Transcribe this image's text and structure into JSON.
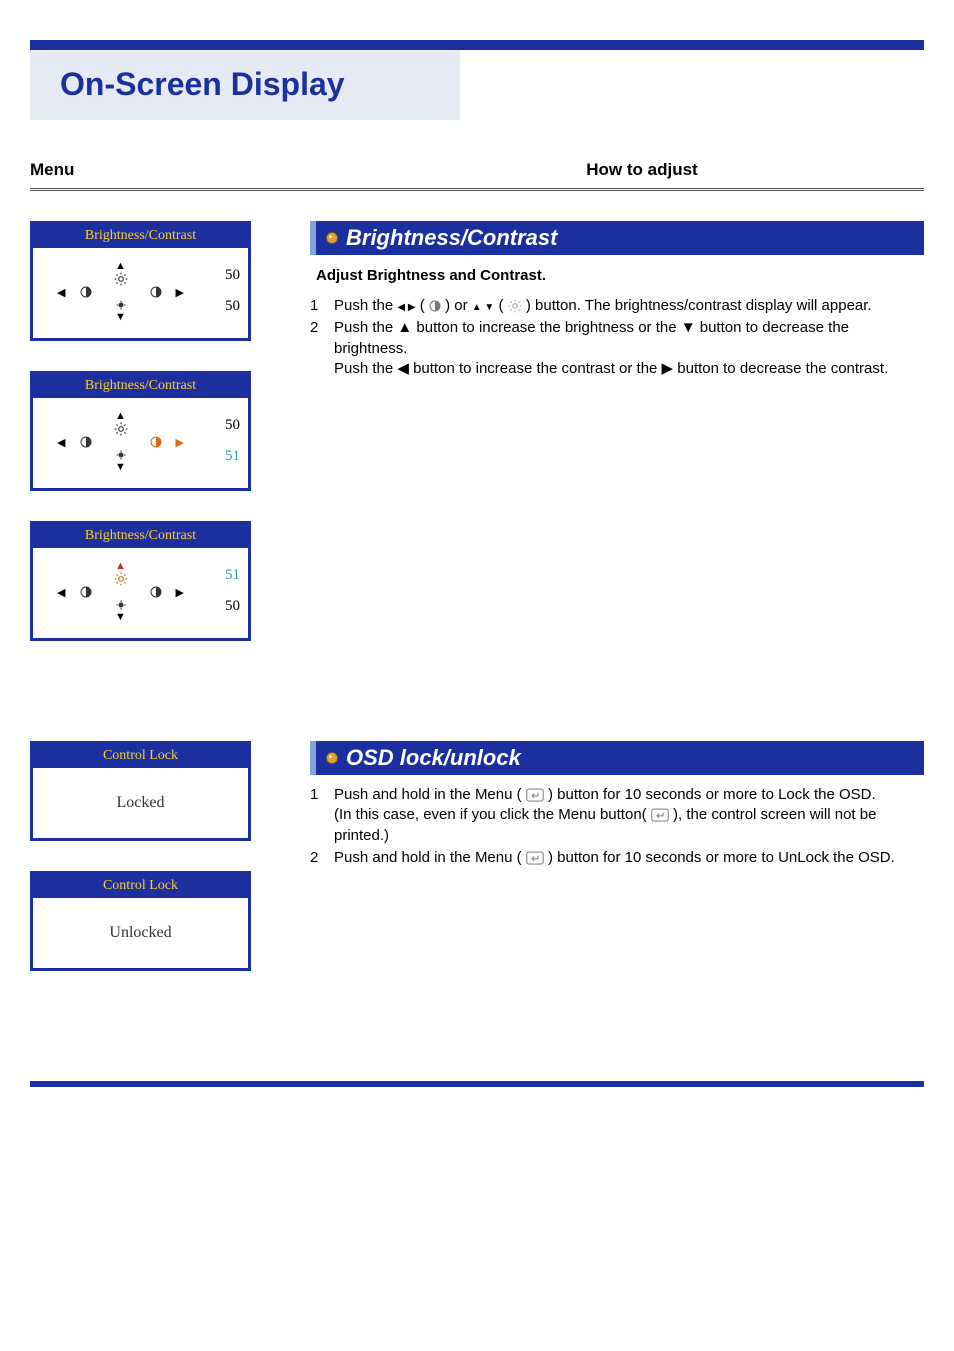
{
  "page_title": "On-Screen Display",
  "columns": {
    "menu": "Menu",
    "how": "How to adjust"
  },
  "osd_bc": [
    {
      "title": "Brightness/Contrast",
      "top": "50",
      "bottom": "50",
      "top_hl": false,
      "bottom_hl": false,
      "right_hl": false,
      "up_hl": false
    },
    {
      "title": "Brightness/Contrast",
      "top": "50",
      "bottom": "51",
      "top_hl": false,
      "bottom_hl": true,
      "right_hl": true,
      "up_hl": false
    },
    {
      "title": "Brightness/Contrast",
      "top": "51",
      "bottom": "50",
      "top_hl": true,
      "bottom_hl": false,
      "right_hl": false,
      "up_hl": true
    }
  ],
  "sec1": {
    "header": "Brightness/Contrast",
    "sub": "Adjust Brightness and Contrast.",
    "step1_pre": "Push the ",
    "step1_arrows1": "◀ ▶",
    "step1_paren_open": " ( ",
    "step1_between": " )  or ",
    "step1_arrows2": "▲ ▼",
    "step1_paren_open2": " ( ",
    "step1_post": " ) button. The brightness/contrast display will appear.",
    "step2a": "Push the ▲ button to increase the brightness or the ▼ button to decrease the brightness.",
    "step2b": "Push the ◀ button to increase the contrast or the ▶ button to decrease the contrast."
  },
  "osd_lock": [
    {
      "title": "Control Lock",
      "body": "Locked"
    },
    {
      "title": "Control Lock",
      "body": "Unlocked"
    }
  ],
  "sec2": {
    "header": "OSD lock/unlock",
    "step1a": "Push and hold in the Menu ( ",
    "step1b": " ) button for 10 seconds or more to Lock the OSD.",
    "step1c": "(In this case, even if you click the Menu button( ",
    "step1d": " ), the control screen will not be printed.)",
    "step2a": "Push and hold in the Menu ( ",
    "step2b": "  ) button for 10 seconds or more to UnLock the OSD."
  },
  "nums": {
    "one": "1",
    "two": "2"
  }
}
